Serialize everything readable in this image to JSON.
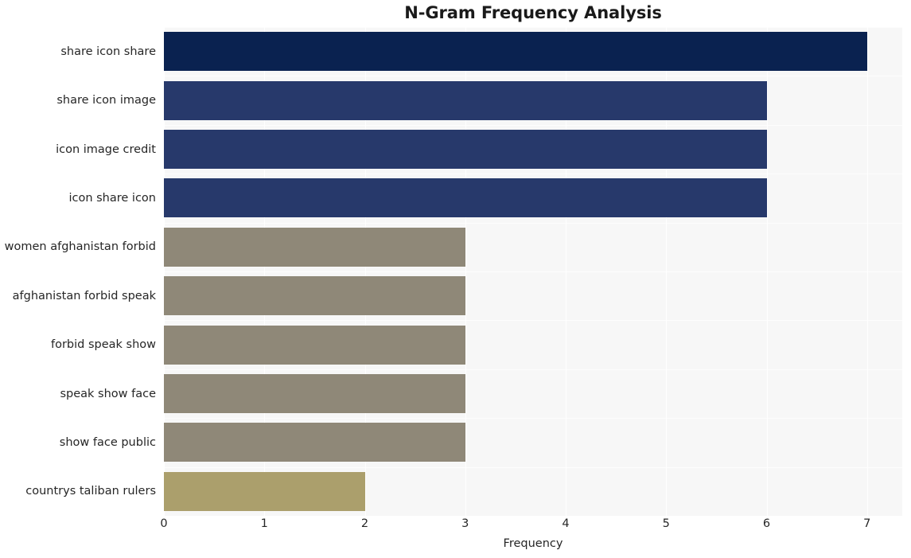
{
  "chart_data": {
    "type": "bar",
    "orientation": "horizontal",
    "title": "N-Gram Frequency Analysis",
    "xlabel": "Frequency",
    "ylabel": "",
    "categories": [
      "share icon share",
      "share icon image",
      "icon image credit",
      "icon share icon",
      "women afghanistan forbid",
      "afghanistan forbid speak",
      "forbid speak show",
      "speak show face",
      "show face public",
      "countrys taliban rulers"
    ],
    "values": [
      7,
      6,
      6,
      6,
      3,
      3,
      3,
      3,
      3,
      2
    ],
    "bar_colors": [
      "#0a2250",
      "#27396b",
      "#27396b",
      "#27396b",
      "#8f8878",
      "#8f8878",
      "#8f8878",
      "#8f8878",
      "#8f8878",
      "#ab9f6c"
    ],
    "xlim": [
      0,
      7.35
    ],
    "xticks": [
      0,
      1,
      2,
      3,
      4,
      5,
      6,
      7
    ],
    "xtick_labels": [
      "0",
      "1",
      "2",
      "3",
      "4",
      "5",
      "6",
      "7"
    ],
    "grid": true,
    "grid_color": "#ffffff",
    "plot_background": "#f7f7f7",
    "figure_background": "#ffffff",
    "legend": null,
    "legend_position": "none"
  }
}
